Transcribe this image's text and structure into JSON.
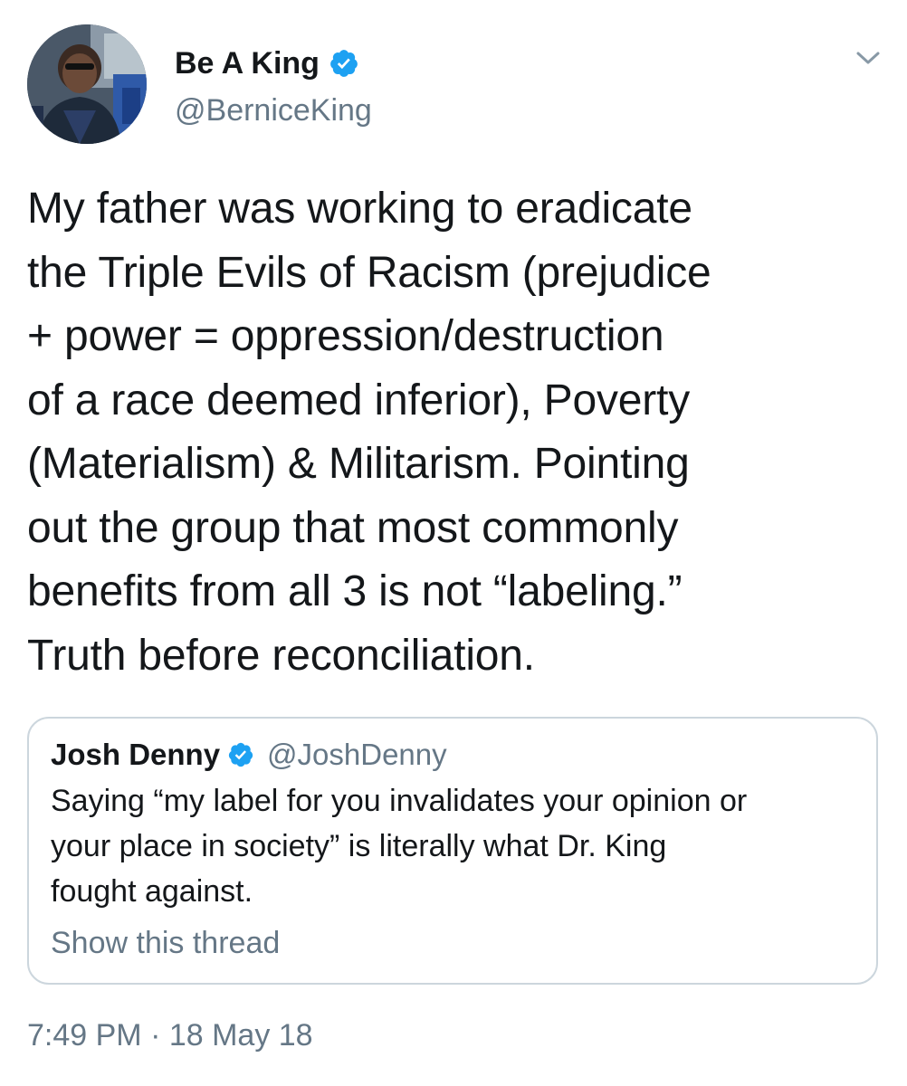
{
  "tweet": {
    "author": {
      "display_name": "Be A King",
      "handle": "@BerniceKing",
      "verified": true,
      "avatar_icon": "profile-photo"
    },
    "menu_icon": "chevron-down-icon",
    "text": "My father was working to eradicate\nthe Triple Evils of Racism (prejudice\n+ power = oppression/destruction\nof a race deemed inferior), Poverty\n(Materialism) & Militarism. Pointing\nout the group that most commonly\nbenefits from all 3 is not “labeling.”\nTruth before reconciliation.",
    "quoted_tweet": {
      "display_name": "Josh Denny",
      "handle": "@JoshDenny",
      "verified": true,
      "text": "Saying “my label for you invalidates your opinion or\nyour place in society” is literally what Dr. King\nfought against.",
      "show_thread_label": "Show this thread"
    },
    "timestamp": "7:49 PM · 18 May 18"
  },
  "colors": {
    "text_primary": "#14171a",
    "text_secondary": "#657786",
    "verified_blue": "#1da1f2",
    "border": "#ccd6dd"
  }
}
